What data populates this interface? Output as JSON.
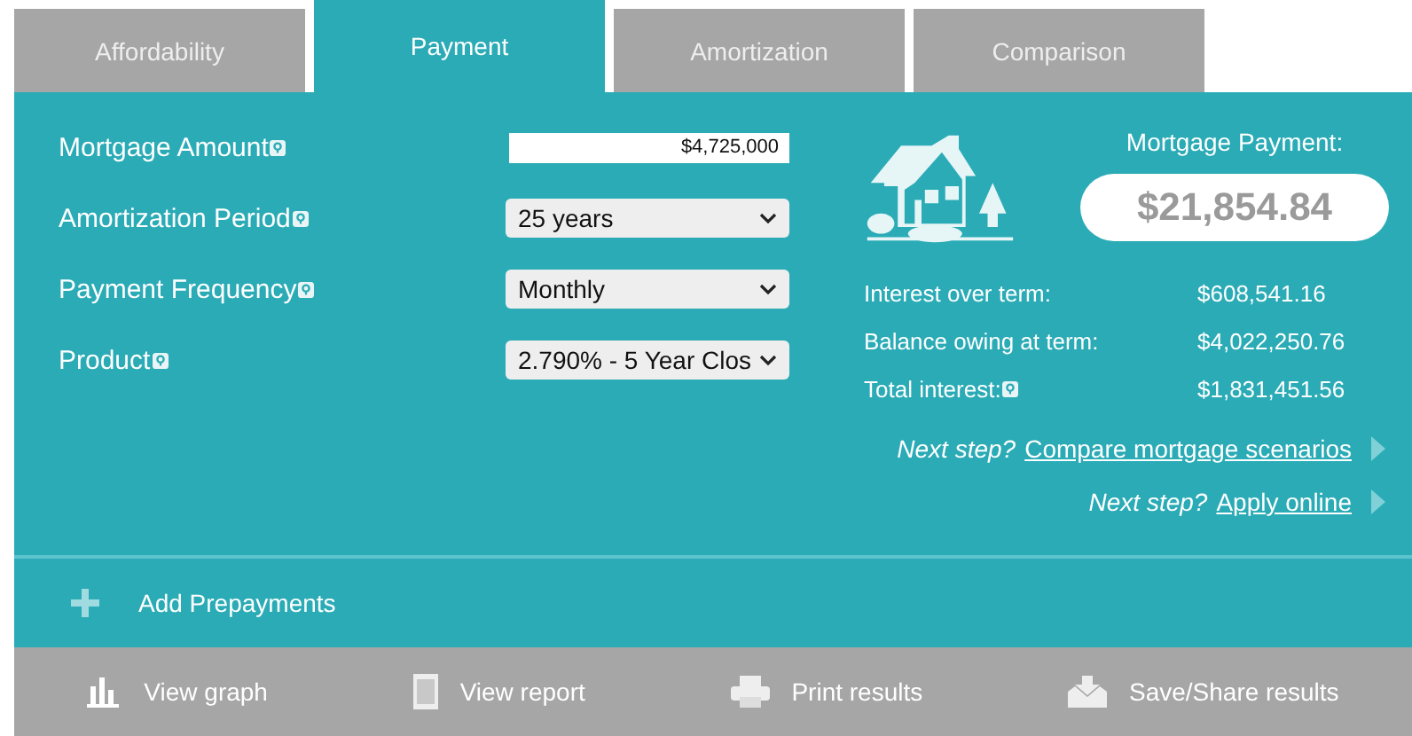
{
  "tabs": [
    {
      "label": "Affordability",
      "selected": false
    },
    {
      "label": "Payment",
      "selected": true
    },
    {
      "label": "Amortization",
      "selected": false
    },
    {
      "label": "Comparison",
      "selected": false
    }
  ],
  "form": [
    {
      "label": "Mortgage Amount",
      "kind": "input",
      "value": "$4,725,000"
    },
    {
      "label": "Amortization Period",
      "kind": "select",
      "value": "25 years"
    },
    {
      "label": "Payment Frequency",
      "kind": "select",
      "value": "Monthly"
    },
    {
      "label": "Product",
      "kind": "select",
      "value": "2.790% - 5 Year Clos"
    }
  ],
  "result": {
    "title": "Mortgage Payment:",
    "amount": "$21,854.84",
    "rows": [
      {
        "label": "Interest over term:",
        "help": false,
        "value": "$608,541.16"
      },
      {
        "label": "Balance owing at term:",
        "help": false,
        "value": "$4,022,250.76"
      },
      {
        "label": "Total interest:",
        "help": true,
        "value": "$1,831,451.56"
      }
    ]
  },
  "next_steps": [
    {
      "prompt": "Next step?",
      "link": "Compare mortgage scenarios"
    },
    {
      "prompt": "Next step?",
      "link": "Apply online"
    }
  ],
  "prepayments": {
    "label": "Add Prepayments"
  },
  "footer": [
    {
      "kind": "graph",
      "label": "View graph"
    },
    {
      "kind": "report",
      "label": "View report"
    },
    {
      "kind": "print",
      "label": "Print results"
    },
    {
      "kind": "save",
      "label": "Save/Share results"
    }
  ]
}
